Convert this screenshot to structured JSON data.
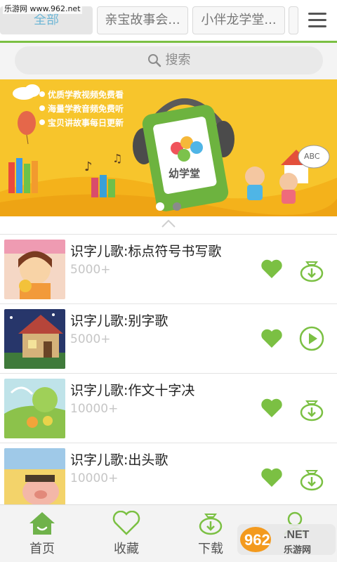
{
  "watermark": "乐游网 www.962.net",
  "tabs": [
    {
      "label": "全部",
      "active": true
    },
    {
      "label": "亲宝故事会..."
    },
    {
      "label": "小伴龙学堂..."
    },
    {
      "label": ""
    }
  ],
  "menu_icon": "hamburger-icon",
  "search": {
    "placeholder": "搜索",
    "icon": "search-icon"
  },
  "banner": {
    "lines": [
      "优质学教视频免费看",
      "海量学教音频免费听",
      "宝贝讲故事每日更新"
    ],
    "app_name": "幼学堂",
    "badge": "ABC",
    "slide_count": 2,
    "active_slide": 1
  },
  "items": [
    {
      "title": "识字儿歌:标点符号书写歌",
      "count": "5000+",
      "favorite": true,
      "action": "download"
    },
    {
      "title": "识字儿歌:别字歌",
      "count": "5000+",
      "favorite": true,
      "action": "play"
    },
    {
      "title": "识字儿歌:作文十字决",
      "count": "10000+",
      "favorite": true,
      "action": "download"
    },
    {
      "title": "识字儿歌:出头歌",
      "count": "10000+",
      "favorite": true,
      "action": "download"
    }
  ],
  "nav": [
    {
      "label": "首页",
      "icon": "home-icon",
      "active": true
    },
    {
      "label": "收藏",
      "icon": "heart-icon"
    },
    {
      "label": "下载",
      "icon": "download-icon"
    },
    {
      "label": "",
      "icon": "user-icon"
    }
  ],
  "stamp": {
    "number": "962",
    "suffix": ".NET",
    "caption": "乐游网"
  },
  "colors": {
    "accent_green": "#7bc043",
    "tab_active_text": "#6fb7d6",
    "banner_bg": "#f7c52c"
  }
}
